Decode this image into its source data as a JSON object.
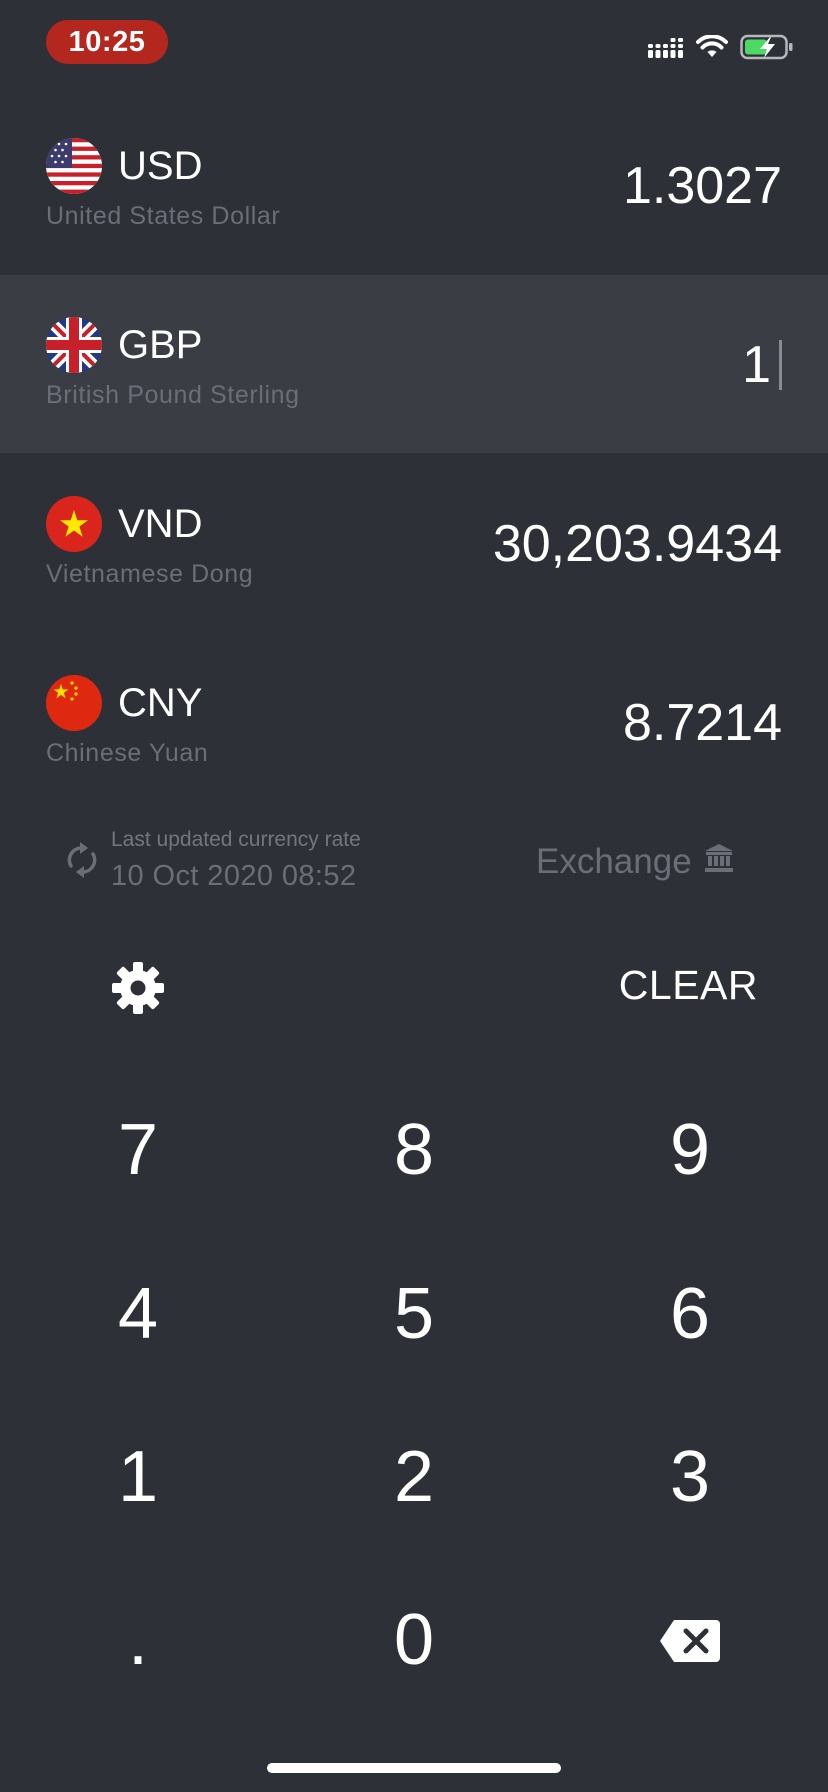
{
  "status_bar": {
    "time": "10:25",
    "signal_icon": "cellular-signal-icon",
    "wifi_icon": "wifi-icon",
    "battery_icon": "battery-charging-icon",
    "time_pill_color": "#b3271f"
  },
  "currencies": [
    {
      "code": "USD",
      "name": "United States Dollar",
      "amount": "1.3027",
      "flag_icon": "us-flag-icon",
      "active": false
    },
    {
      "code": "GBP",
      "name": "British Pound Sterling",
      "amount": "1",
      "flag_icon": "uk-flag-icon",
      "active": true
    },
    {
      "code": "VND",
      "name": "Vietnamese Dong",
      "amount": "30,203.9434",
      "flag_icon": "vietnam-flag-icon",
      "active": false
    },
    {
      "code": "CNY",
      "name": "Chinese Yuan",
      "amount": "8.7214",
      "flag_icon": "china-flag-icon",
      "active": false
    }
  ],
  "info": {
    "updated_label": "Last updated currency rate",
    "updated_date": "10 Oct 2020 08:52",
    "refresh_icon": "refresh-icon",
    "exchange_label": "Exchange",
    "exchange_icon": "bank-icon"
  },
  "keypad": {
    "settings_icon": "gear-icon",
    "clear_label": "CLEAR",
    "keys": [
      "7",
      "8",
      "9",
      "4",
      "5",
      "6",
      "1",
      "2",
      "3",
      ".",
      "0"
    ],
    "backspace_icon": "backspace-icon"
  },
  "colors": {
    "background": "#2e3037",
    "active_row": "#3b3d45",
    "muted_text": "#6b6e77"
  }
}
